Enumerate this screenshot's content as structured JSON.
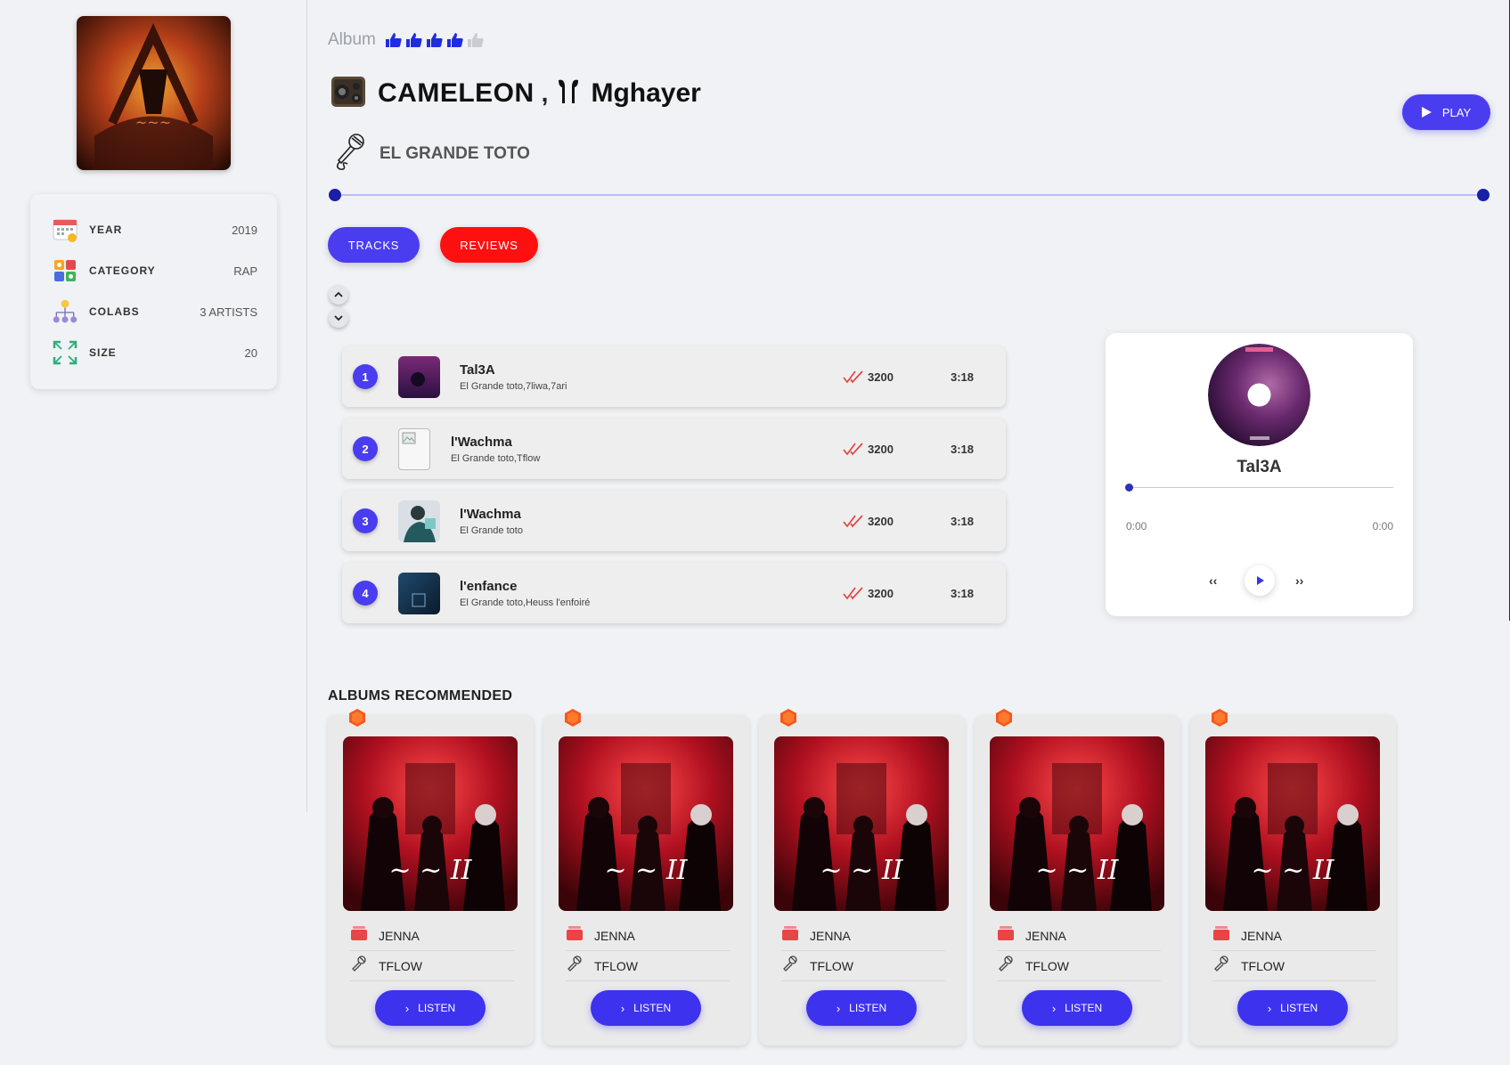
{
  "sidebar": {
    "info": [
      {
        "label": "YEAR",
        "value": "2019",
        "icon": "calendar-icon"
      },
      {
        "label": "CATEGORY",
        "value": "RAP",
        "icon": "category-grid-icon"
      },
      {
        "label": "COLABS",
        "value": "3 ARTISTS",
        "icon": "network-icon"
      },
      {
        "label": "SIZE",
        "value": "20",
        "icon": "expand-icon"
      }
    ]
  },
  "header": {
    "album_label": "Album",
    "rating": {
      "value": 4,
      "max": 5
    },
    "title": "CAMELEON",
    "comma": ",",
    "subtitle": "Mghayer",
    "artist": "EL GRANDE TOTO",
    "play_label": "PLAY"
  },
  "tabs": {
    "tracks": "TRACKS",
    "reviews": "REVIEWS"
  },
  "tracks": [
    {
      "num": "1",
      "name": "Tal3A",
      "artists": "El Grande toto,7liwa,7ari",
      "plays": "3200",
      "duration": "3:18"
    },
    {
      "num": "2",
      "name": "l'Wachma",
      "artists": "El Grande toto,Tflow",
      "plays": "3200",
      "duration": "3:18"
    },
    {
      "num": "3",
      "name": "l'Wachma",
      "artists": "El Grande toto",
      "plays": "3200",
      "duration": "3:18"
    },
    {
      "num": "4",
      "name": "l'enfance",
      "artists": "El Grande toto,Heuss l'enfoiré",
      "plays": "3200",
      "duration": "3:18"
    }
  ],
  "player": {
    "title": "Tal3A",
    "time_current": "0:00",
    "time_total": "0:00",
    "prev": "‹‹",
    "next": "››",
    "progress": 0
  },
  "recommended": {
    "title": "ALBUMS RECOMMENDED",
    "items": [
      {
        "album": "JENNA",
        "artist": "TFLOW",
        "button": "LISTEN"
      },
      {
        "album": "JENNA",
        "artist": "TFLOW",
        "button": "LISTEN"
      },
      {
        "album": "JENNA",
        "artist": "TFLOW",
        "button": "LISTEN"
      },
      {
        "album": "JENNA",
        "artist": "TFLOW",
        "button": "LISTEN"
      },
      {
        "album": "JENNA",
        "artist": "TFLOW",
        "button": "LISTEN"
      }
    ]
  },
  "colors": {
    "accent": "#4a3df0",
    "danger": "#ff1010",
    "slider_dot": "#1a1fa8"
  }
}
